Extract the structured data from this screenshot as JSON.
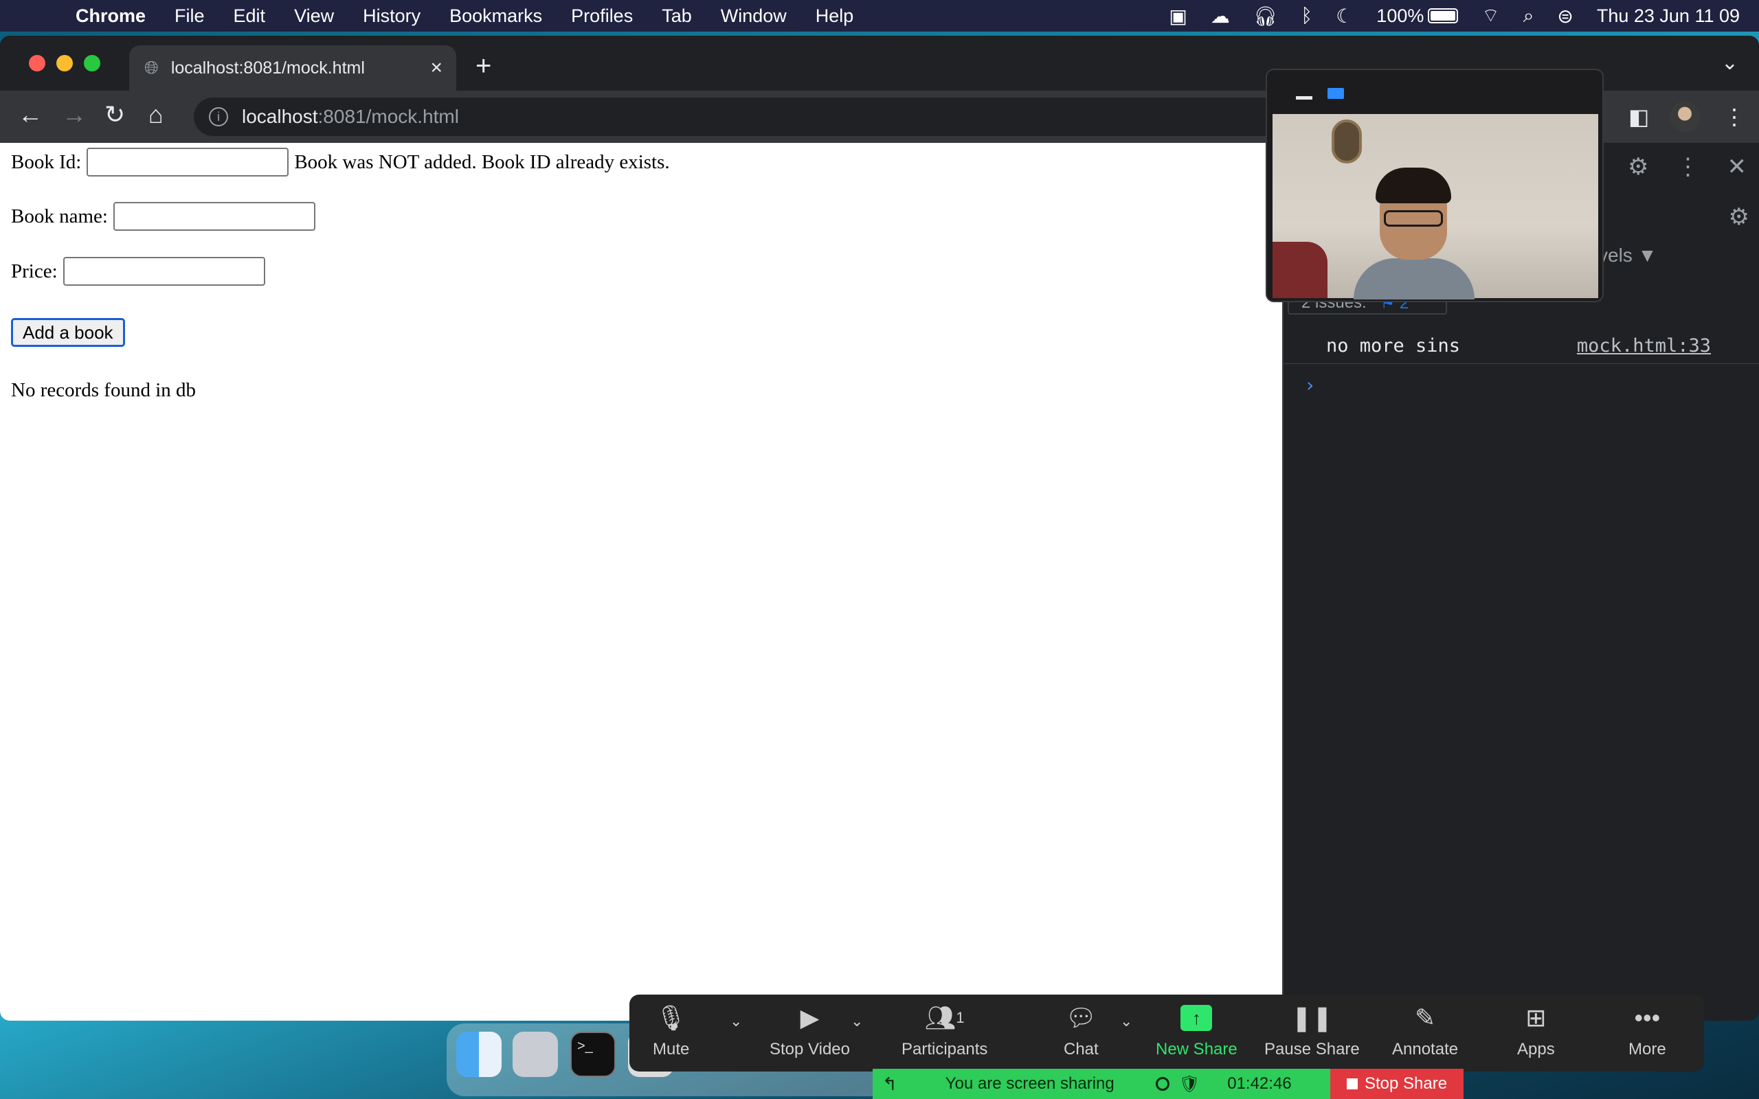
{
  "menubar": {
    "app_name": "Chrome",
    "items": [
      "File",
      "Edit",
      "View",
      "History",
      "Bookmarks",
      "Profiles",
      "Tab",
      "Window",
      "Help"
    ],
    "battery": "100%",
    "datetime": "Thu 23 Jun  11 09"
  },
  "browser": {
    "tab_title": "localhost:8081/mock.html",
    "url_host": "localhost",
    "url_path": ":8081/mock.html"
  },
  "page": {
    "book_id_label": "Book Id:",
    "status_message": "Book was NOT added. Book ID already exists.",
    "book_name_label": "Book name:",
    "price_label": "Price:",
    "add_button": "Add a book",
    "records_message": "No records found in db"
  },
  "devtools": {
    "levels_label": "vels ▼",
    "issues_text": "2 issues:",
    "issues_count": "2",
    "console_message": "no more sins",
    "console_source": "mock.html:33"
  },
  "zoom": {
    "controls": {
      "mute": "Mute",
      "stop_video": "Stop Video",
      "participants": "Participants",
      "participants_count": "1",
      "chat": "Chat",
      "new_share": "New Share",
      "pause_share": "Pause Share",
      "annotate": "Annotate",
      "apps": "Apps",
      "more": "More"
    },
    "share_status": "You are screen sharing",
    "share_timer": "01:42:46",
    "stop_share": "Stop Share",
    "accent_color": "#2ee66b",
    "stop_color": "#e0383e"
  }
}
